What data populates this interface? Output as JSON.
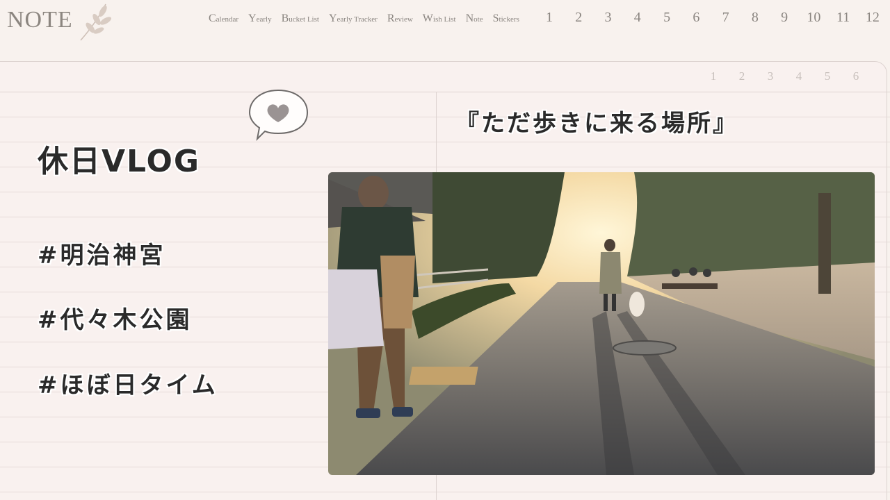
{
  "header": {
    "logo": "NOTE",
    "nav": [
      {
        "cap": "C",
        "rest": "alendar"
      },
      {
        "cap": "Y",
        "rest": "early"
      },
      {
        "cap": "B",
        "rest": "ucket List"
      },
      {
        "cap": "Y",
        "rest": "early Tracker"
      },
      {
        "cap": "R",
        "rest": "eview"
      },
      {
        "cap": "W",
        "rest": "ish List"
      },
      {
        "cap": "N",
        "rest": "ote"
      },
      {
        "cap": "S",
        "rest": "tickers"
      }
    ],
    "months": [
      "1",
      "2",
      "3",
      "4",
      "5",
      "6",
      "7",
      "8",
      "9",
      "10",
      "11",
      "12"
    ]
  },
  "page": {
    "week_days": [
      "1",
      "2",
      "3",
      "4",
      "5",
      "6"
    ],
    "title": "休日VLOG",
    "tags": [
      "#明治神宮",
      "#代々木公園",
      "#ほぼ日タイム"
    ],
    "quote": "『ただ歩きに来る場所』"
  },
  "colors": {
    "paper": "#f9f1ef",
    "rule": "#e4dbd8",
    "nav_text": "#8a8580",
    "bubble_heart": "#9a9393"
  },
  "icons": {
    "logo_leaf": "leaf-sprig-icon",
    "bubble": "speech-bubble-heart-icon"
  }
}
